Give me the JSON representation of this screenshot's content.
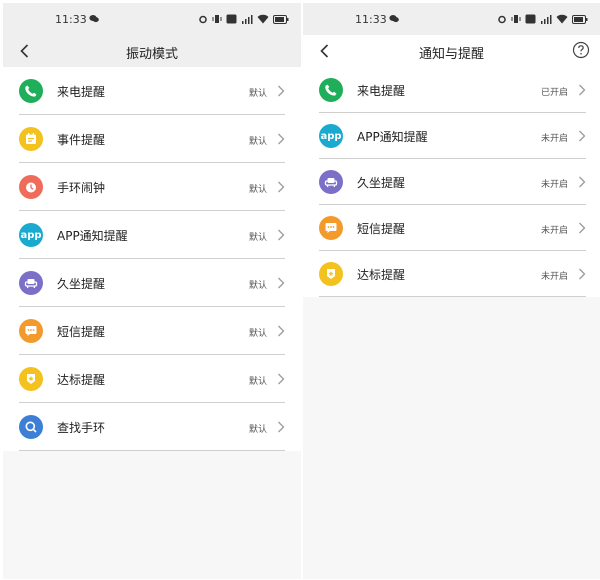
{
  "colors": {
    "status_bar_bg": "#efefef",
    "page_bg": "#f7f7f7",
    "green": "#1fae5a",
    "yellow": "#f4c21e",
    "red": "#ef6c5b",
    "cyan": "#1aa9cf",
    "purple": "#7b6fc8",
    "orange": "#f39a2c",
    "blue": "#3e7fd6"
  },
  "left": {
    "status_time": "11:33",
    "title": "振动模式",
    "items": [
      {
        "icon": "phone-icon",
        "label": "来电提醒",
        "status": "默认"
      },
      {
        "icon": "calendar-icon",
        "label": "事件提醒",
        "status": "默认"
      },
      {
        "icon": "alarm-clock-icon",
        "label": "手环闹钟",
        "status": "默认"
      },
      {
        "icon": "app-icon",
        "icon_text": "app",
        "label": "APP通知提醒",
        "status": "默认"
      },
      {
        "icon": "sofa-icon",
        "label": "久坐提醒",
        "status": "默认"
      },
      {
        "icon": "message-icon",
        "label": "短信提醒",
        "status": "默认"
      },
      {
        "icon": "badge-icon",
        "label": "达标提醒",
        "status": "默认"
      },
      {
        "icon": "search-icon",
        "label": "查找手环",
        "status": "默认"
      }
    ]
  },
  "right": {
    "status_time": "11:33",
    "title": "通知与提醒",
    "items": [
      {
        "icon": "phone-icon",
        "label": "来电提醒",
        "status": "已开启"
      },
      {
        "icon": "app-icon",
        "icon_text": "app",
        "label": "APP通知提醒",
        "status": "未开启"
      },
      {
        "icon": "sofa-icon",
        "label": "久坐提醒",
        "status": "未开启"
      },
      {
        "icon": "message-icon",
        "label": "短信提醒",
        "status": "未开启"
      },
      {
        "icon": "badge-icon",
        "label": "达标提醒",
        "status": "未开启"
      }
    ]
  }
}
